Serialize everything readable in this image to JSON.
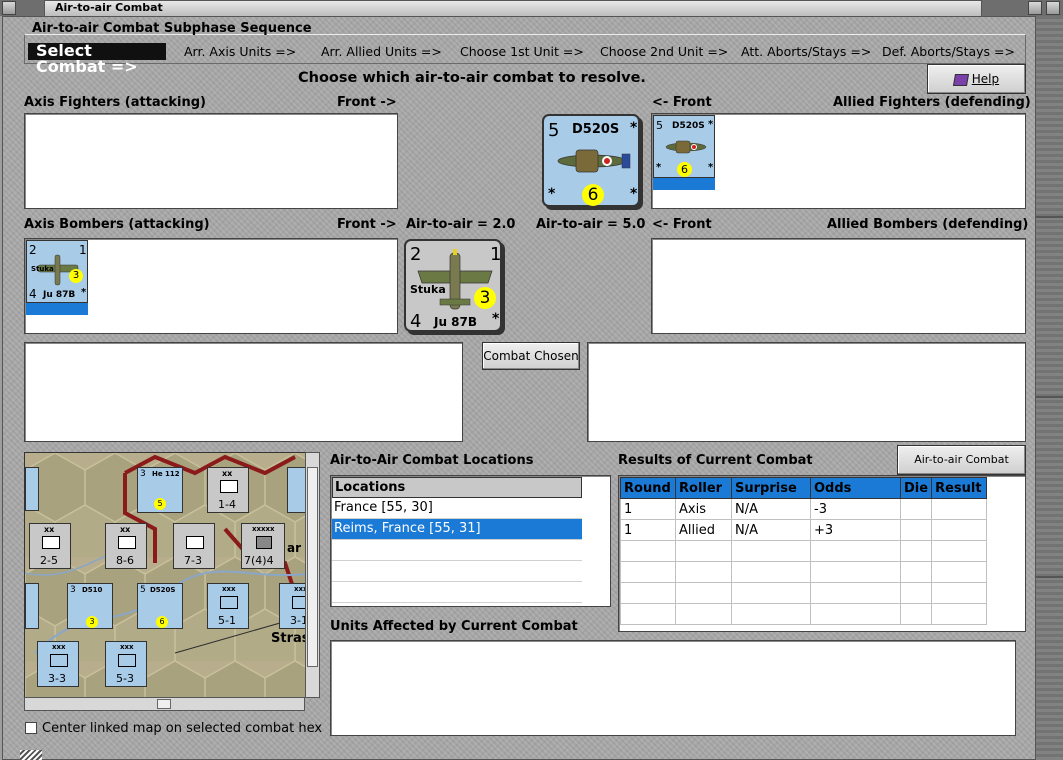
{
  "window": {
    "title": "Air-to-air Combat"
  },
  "sequence": {
    "title": "Air-to-air Combat Subphase Sequence",
    "steps": [
      "Select Combat =>",
      "Arr. Axis Units =>",
      "Arr. Allied Units =>",
      "Choose 1st Unit =>",
      "Choose 2nd Unit =>",
      "Att. Aborts/Stays =>",
      "Def. Aborts/Stays =>"
    ]
  },
  "instruction": "Choose which air-to-air combat to resolve.",
  "help_label": "Help",
  "axis_fighters_label": "Axis Fighters (attacking)",
  "front_right": "Front ->",
  "front_left": "<- Front",
  "allied_fighters_label": "Allied Fighters (defending)",
  "axis_bombers_label": "Axis Bombers (attacking)",
  "allied_bombers_label": "Allied Bombers (defending)",
  "axis_a2a": "Air-to-air = 2.0",
  "allied_a2a": "Air-to-air = 5.0",
  "combat_chosen_label": "Combat Chosen",
  "allied_unit": {
    "tl": "5",
    "name": "D520S",
    "tr": "*",
    "val": "6",
    "bl": "*",
    "br": "*"
  },
  "axis_unit": {
    "tl": "2",
    "tr": "1",
    "mid": "Stuka",
    "val": "3",
    "bl": "4",
    "name": "Ju 87B",
    "br": "*"
  },
  "locations": {
    "title": "Air-to-Air Combat Locations",
    "header": "Locations",
    "items": [
      "France [55, 30]",
      "Reims, France [55, 31]"
    ],
    "selected_index": 1
  },
  "results": {
    "title": "Results of Current Combat",
    "chart_button": "Air-to-air Combat Chart",
    "columns": [
      "Round",
      "Roller",
      "Surprise",
      "Odds",
      "Die",
      "Result"
    ],
    "rows": [
      [
        "1",
        "Axis",
        "N/A",
        "-3",
        "",
        ""
      ],
      [
        "1",
        "Allied",
        "N/A",
        "+3",
        "",
        ""
      ]
    ]
  },
  "units_affected_label": "Units Affected by Current Combat",
  "center_map_label": "Center linked map on selected combat hex",
  "center_map_checked": false,
  "map": {
    "counters": [
      {
        "top": "3",
        "label": "He 112",
        "val": "5"
      },
      {
        "top": "xx",
        "label": "1-4"
      },
      {
        "top": "xx",
        "label": "2-5"
      },
      {
        "top": "xx",
        "label": "8-6"
      },
      {
        "top": "",
        "label": "7-3"
      },
      {
        "top": "xxxxx",
        "label": "7(4)4"
      },
      {
        "top": "3",
        "label": "D510",
        "val": "3"
      },
      {
        "top": "5",
        "label": "D520S",
        "val": "6"
      },
      {
        "top": "xxx",
        "label": "5-1"
      },
      {
        "top": "xxx",
        "label": "3-1"
      },
      {
        "top": "xxx",
        "label": "3-3"
      },
      {
        "top": "xxx",
        "label": "5-3"
      }
    ],
    "labels": [
      "Stras",
      "ar"
    ]
  },
  "colors": {
    "unit_blue": "#a8cbe8",
    "selection_blue": "#1a7ad6",
    "value_yellow": "#ffff00",
    "map_hex_border": "#8b1a1a"
  }
}
